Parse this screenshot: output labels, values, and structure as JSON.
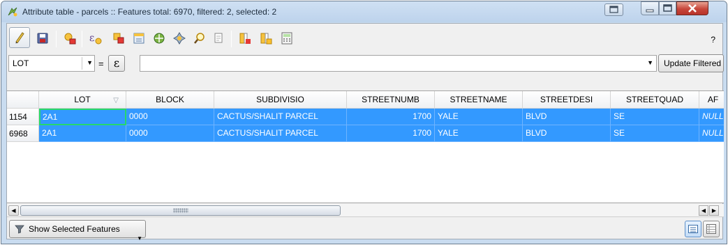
{
  "window": {
    "title": "Attribute table - parcels :: Features total: 6970, filtered: 2, selected: 2"
  },
  "toolbar": {
    "help_label": "?"
  },
  "filter": {
    "field_value": "LOT",
    "operator": "=",
    "expression_button": "ε",
    "update_label": "Update Filtered"
  },
  "table": {
    "columns": [
      "LOT",
      "BLOCK",
      "SUBDIVISIO",
      "STREETNUMB",
      "STREETNAME",
      "STREETDESI",
      "STREETQUAD",
      "AF"
    ],
    "rows": [
      {
        "id": "1154",
        "cells": [
          "2A1",
          "0000",
          "CACTUS/SHALIT PARCEL",
          "1700",
          "YALE",
          "BLVD",
          "SE",
          "NULL"
        ]
      },
      {
        "id": "6968",
        "cells": [
          "2A1",
          "0000",
          "CACTUS/SHALIT PARCEL",
          "1700",
          "YALE",
          "BLVD",
          "SE",
          "NULL"
        ]
      }
    ]
  },
  "bottom": {
    "show_label": "Show Selected Features"
  },
  "colors": {
    "selection": "#3399ff",
    "current_cell_border": "#27d86b",
    "close_button": "#c7463a"
  }
}
